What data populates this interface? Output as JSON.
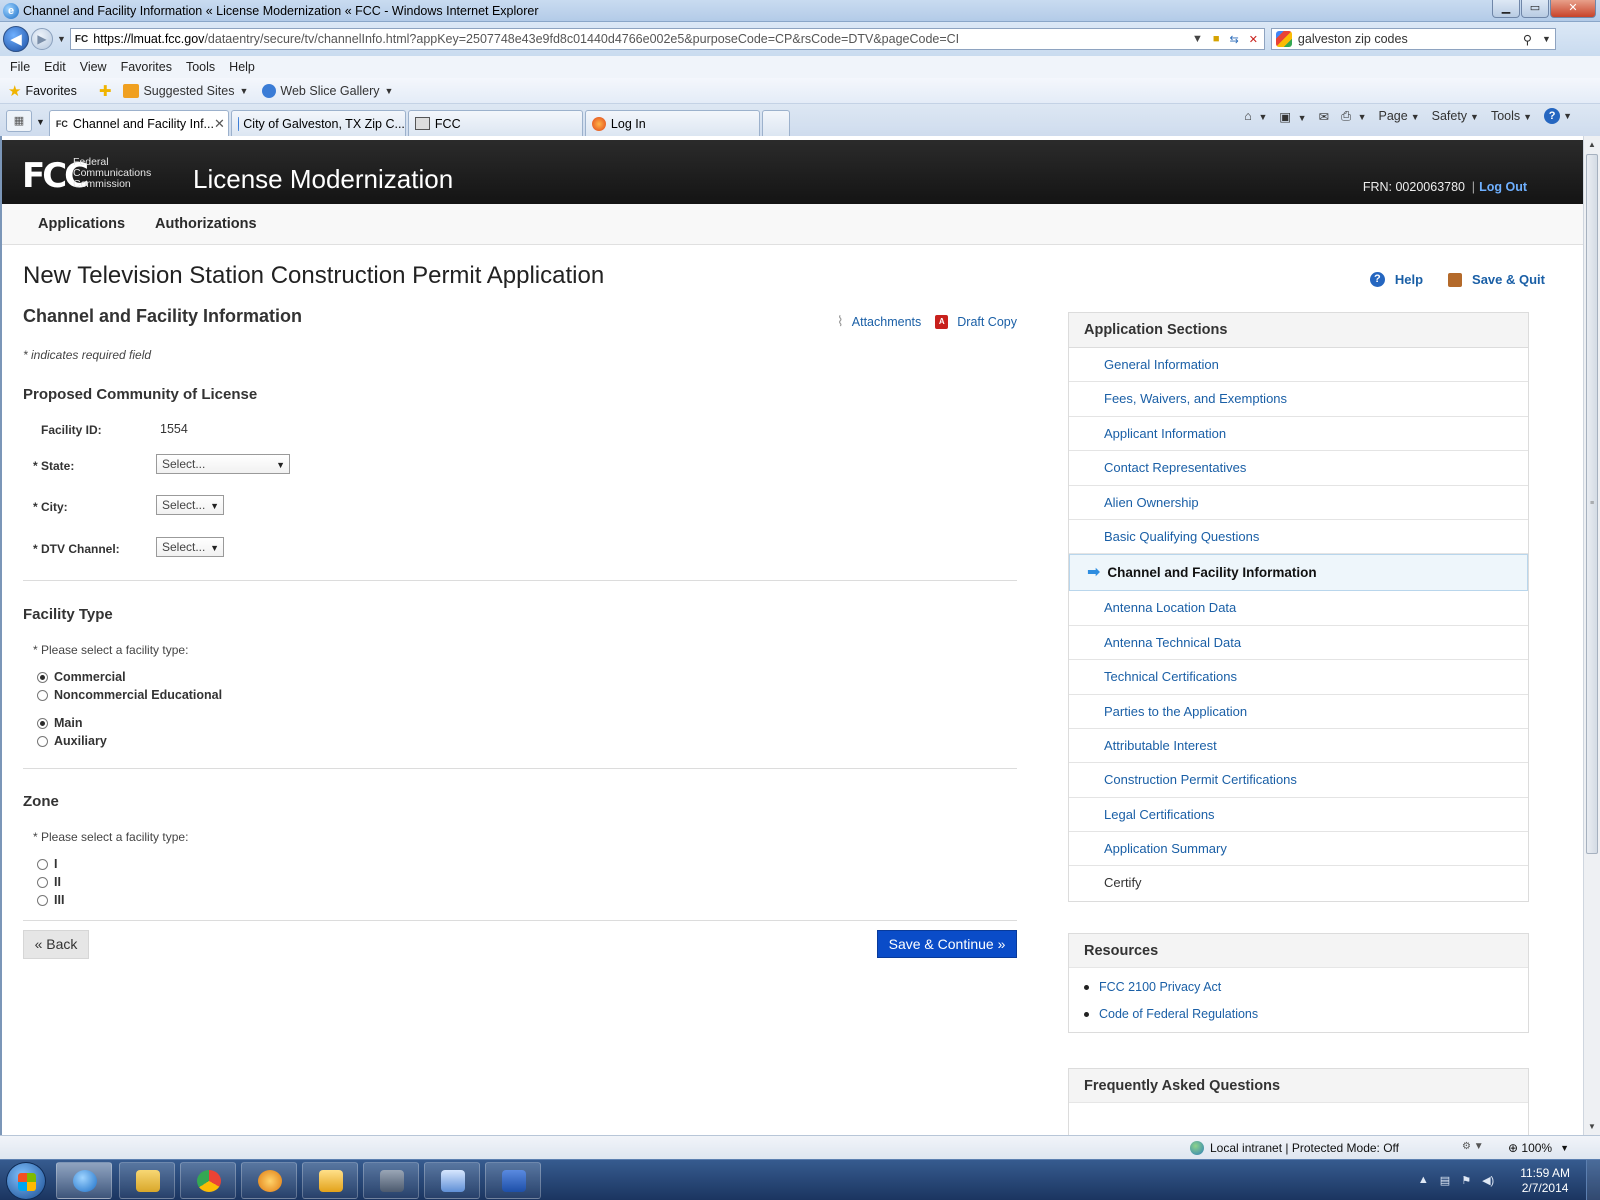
{
  "window": {
    "title": "Channel and Facility Information « License Modernization « FCC - Windows Internet Explorer",
    "controls": {
      "minimize": "▁",
      "maximize": "▭",
      "close": "✕"
    }
  },
  "address": {
    "favicon": "FC",
    "url_host": "https://lmuat.fcc.gov",
    "url_path": "/dataentry/secure/tv/channelInfo.html?appKey=2507748e43e9fd8c01440d4766e002e5&purposeCode=CP&rsCode=DTV&pageCode=CI",
    "search_value": "galveston zip codes"
  },
  "menu": [
    "File",
    "Edit",
    "View",
    "Favorites",
    "Tools",
    "Help"
  ],
  "favorites": {
    "label": "Favorites",
    "suggested": "Suggested Sites",
    "web_slice": "Web Slice Gallery"
  },
  "tabs": [
    {
      "label": "Channel and Facility Inf..."
    },
    {
      "label": "City of Galveston, TX Zip C..."
    },
    {
      "label": "FCC"
    },
    {
      "label": "Log In"
    }
  ],
  "command_bar": {
    "page": "Page",
    "safety": "Safety",
    "tools": "Tools"
  },
  "site": {
    "logo": "FCC",
    "agency_line1": "Federal",
    "agency_line2": "Communications",
    "agency_line3": "Commission",
    "app_name": "License Modernization",
    "frn": "FRN: 0020063780",
    "separator": "|",
    "logout": "Log Out",
    "nav": [
      "Applications",
      "Authorizations"
    ]
  },
  "page": {
    "title": "New Television Station Construction Permit Application",
    "help": "Help",
    "save_quit": "Save & Quit"
  },
  "form": {
    "section_title": "Channel and Facility Information",
    "attachments": "Attachments",
    "draft_copy": "Draft Copy",
    "required_note": "* indicates required field",
    "community": {
      "heading": "Proposed Community of License",
      "facility_id_label": "Facility ID:",
      "facility_id_value": "1554",
      "state_label": "* State:",
      "state_value": "Select...",
      "city_label": "* City:",
      "city_value": "Select...",
      "channel_label": "* DTV Channel:",
      "channel_value": "Select..."
    },
    "facility_type": {
      "heading": "Facility Type",
      "prompt": "* Please select a facility type:",
      "options": [
        {
          "label": "Commercial",
          "selected": true
        },
        {
          "label": "Noncommercial Educational",
          "selected": false
        },
        {
          "label": "Main",
          "selected": true
        },
        {
          "label": "Auxiliary",
          "selected": false
        }
      ]
    },
    "zone": {
      "heading": "Zone",
      "prompt": "* Please select a facility type:",
      "options": [
        {
          "label": "I",
          "selected": false
        },
        {
          "label": "II",
          "selected": false
        },
        {
          "label": "III",
          "selected": false
        }
      ]
    },
    "back": "« Back",
    "save_continue": "Save & Continue »"
  },
  "sidebar": {
    "heading": "Application Sections",
    "items": [
      "General Information",
      "Fees, Waivers, and Exemptions",
      "Applicant Information",
      "Contact Representatives",
      "Alien Ownership",
      "Basic Qualifying Questions",
      "Channel and Facility Information",
      "Antenna Location Data",
      "Antenna Technical Data",
      "Technical Certifications",
      "Parties to the Application",
      "Attributable Interest",
      "Construction Permit Certifications",
      "Legal Certifications",
      "Application Summary",
      "Certify"
    ]
  },
  "resources": {
    "heading": "Resources",
    "links": [
      "FCC 2100 Privacy Act",
      "Code of Federal Regulations"
    ]
  },
  "faq": {
    "heading": "Frequently Asked Questions"
  },
  "status": {
    "zone": "Local intranet | Protected Mode: Off",
    "zoom": "100%"
  },
  "taskbar": {
    "time": "11:59 AM",
    "date": "2/7/2014"
  }
}
